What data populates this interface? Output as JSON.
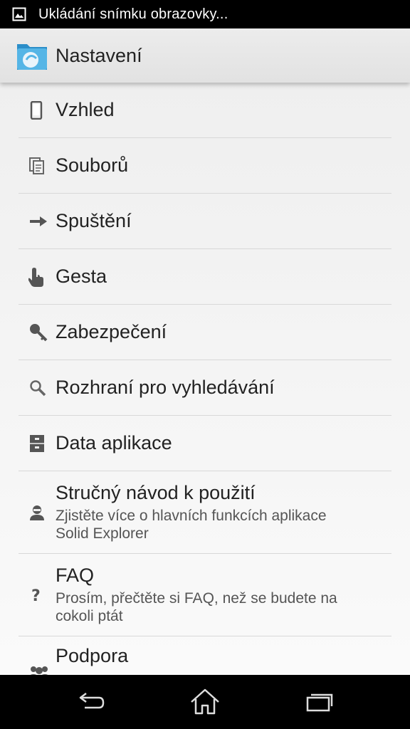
{
  "status_bar": {
    "icon": "image-icon",
    "text": "Ukládání snímku obrazovky..."
  },
  "action_bar": {
    "app_icon": "solid-explorer-icon",
    "title": "Nastavení"
  },
  "settings": [
    {
      "icon": "phone-icon",
      "title": "Vzhled"
    },
    {
      "icon": "files-icon",
      "title": "Souborů"
    },
    {
      "icon": "arrow-icon",
      "title": "Spuštění"
    },
    {
      "icon": "hand-icon",
      "title": "Gesta"
    },
    {
      "icon": "key-icon",
      "title": "Zabezpečení"
    },
    {
      "icon": "search-icon",
      "title": "Rozhraní pro vyhledávání"
    },
    {
      "icon": "cabinet-icon",
      "title": "Data aplikace"
    },
    {
      "icon": "person-icon",
      "title": "Stručný návod k použití",
      "subtitle_1": "Zjistěte více o hlavních funkcích aplikace",
      "subtitle_2": "Solid Explorer"
    },
    {
      "icon": "question-icon",
      "title": "FAQ",
      "subtitle_1": "Prosím, přečtěte si FAQ, než se budete na",
      "subtitle_2": "cokoli ptát"
    },
    {
      "icon": "group-icon",
      "title": "Podpora"
    }
  ],
  "nav_bar": {
    "back_icon": "back-icon",
    "home_icon": "home-icon",
    "recents_icon": "recents-icon"
  }
}
